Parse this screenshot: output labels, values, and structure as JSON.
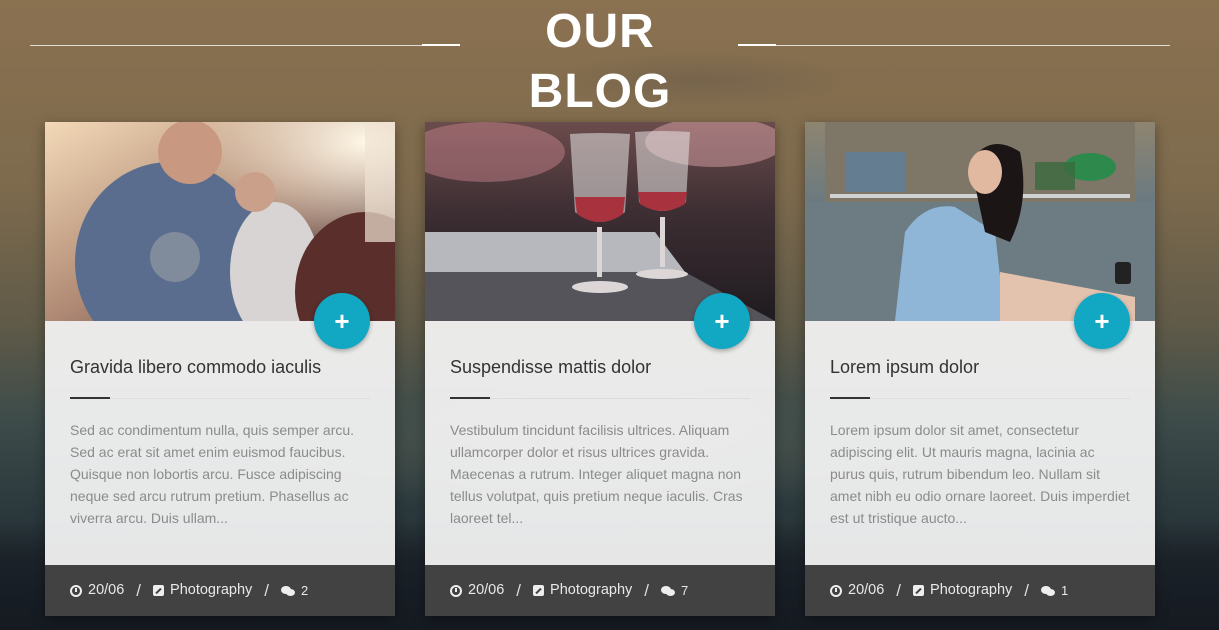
{
  "header": {
    "title": "OUR BLOG"
  },
  "posts": [
    {
      "title": "Gravida libero commodo iaculis",
      "excerpt": "Sed ac condimentum nulla, quis semper arcu. Sed ac erat sit amet enim euismod faucibus. Quisque non lobortis arcu. Fusce adipiscing neque sed arcu rutrum pretium. Phasellus ac viverra arcu. Duis ullam...",
      "date": "20/06",
      "category": "Photography",
      "comments": "2",
      "plus_icon": "+"
    },
    {
      "title": "Suspendisse mattis dolor",
      "excerpt": "Vestibulum tincidunt facilisis ultrices. Aliquam ullamcorper dolor et risus ultrices gravida. Maecenas a rutrum. Integer aliquet magna non tellus volutpat, quis pretium neque iaculis. Cras laoreet tel...",
      "date": "20/06",
      "category": "Photography",
      "comments": "7",
      "plus_icon": "+"
    },
    {
      "title": "Lorem ipsum dolor",
      "excerpt": "Lorem ipsum dolor sit amet, consectetur adipiscing elit. Ut mauris magna, lacinia ac purus quis, rutrum bibendum leo. Nullam sit amet nibh eu odio ornare laoreet. Duis imperdiet est ut tristique aucto...",
      "date": "20/06",
      "category": "Photography",
      "comments": "1",
      "plus_icon": "+"
    }
  ],
  "separator": "/",
  "colors": {
    "accent": "#12a8c4",
    "footer_bg": "#424242",
    "card_bg": "#f5f5f5"
  },
  "icons": {
    "date": "clock-icon",
    "category": "edit-icon",
    "comments": "comments-icon",
    "plus": "plus-icon"
  }
}
